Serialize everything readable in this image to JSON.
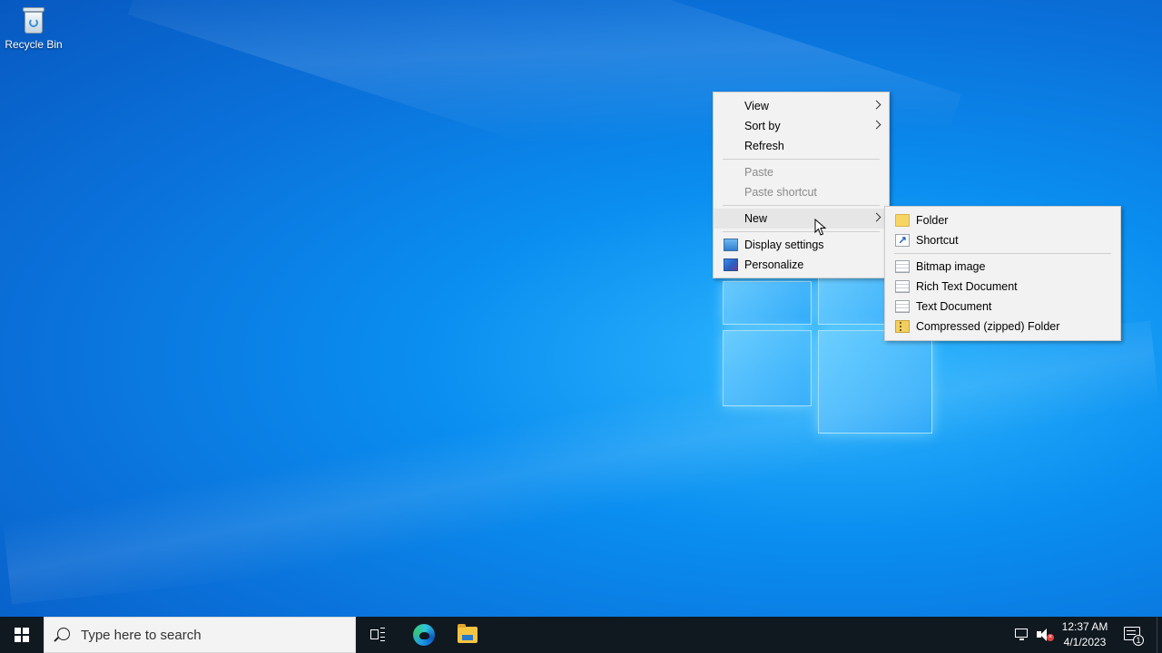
{
  "desktop": {
    "icons": [
      {
        "label": "Recycle Bin",
        "icon": "recycle-bin-icon"
      }
    ]
  },
  "context_menu": {
    "items": [
      {
        "label": "View",
        "submenu": true,
        "disabled": false
      },
      {
        "label": "Sort by",
        "submenu": true,
        "disabled": false
      },
      {
        "label": "Refresh",
        "submenu": false,
        "disabled": false
      },
      {
        "label": "Paste",
        "submenu": false,
        "disabled": true
      },
      {
        "label": "Paste shortcut",
        "submenu": false,
        "disabled": true
      },
      {
        "label": "New",
        "submenu": true,
        "disabled": false,
        "highlighted": true
      },
      {
        "label": "Display settings",
        "icon": "display-settings-icon"
      },
      {
        "label": "Personalize",
        "icon": "personalize-icon"
      }
    ]
  },
  "new_submenu": {
    "items": [
      {
        "label": "Folder",
        "icon": "folder-icon"
      },
      {
        "label": "Shortcut",
        "icon": "shortcut-icon"
      },
      {
        "label": "Bitmap image",
        "icon": "bitmap-image-icon"
      },
      {
        "label": "Rich Text Document",
        "icon": "rich-text-document-icon"
      },
      {
        "label": "Text Document",
        "icon": "text-document-icon"
      },
      {
        "label": "Compressed (zipped) Folder",
        "icon": "zip-folder-icon"
      }
    ]
  },
  "taskbar": {
    "search_placeholder": "Type here to search",
    "apps": [
      "task-view-icon",
      "edge-icon",
      "file-explorer-icon"
    ],
    "clock": {
      "time": "12:37 AM",
      "date": "4/1/2023"
    },
    "notification_count": "1"
  },
  "colors": {
    "taskbar": "#101820",
    "menu_bg": "#f2f2f2",
    "menu_hover": "#e6e6e6",
    "disabled_text": "#8a8a8a",
    "desktop_accent": "#0a8ef0"
  }
}
